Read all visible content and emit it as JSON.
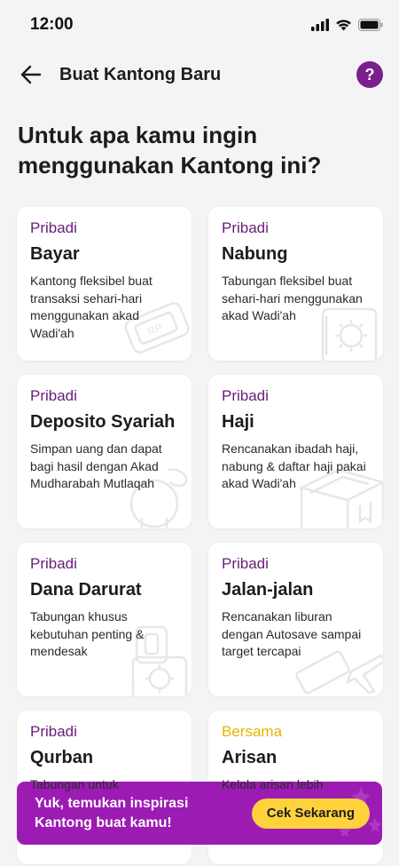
{
  "status_bar": {
    "time": "12:00"
  },
  "header": {
    "title": "Buat Kantong Baru",
    "help_label": "?"
  },
  "question": {
    "line1": "Untuk apa kamu ingin",
    "line2": "menggunakan Kantong ini?"
  },
  "cards": [
    {
      "category": "Pribadi",
      "title": "Bayar",
      "desc": "Kantong fleksibel buat transaksi sehari-hari menggunakan akad Wadi'ah",
      "icon": "card-icon"
    },
    {
      "category": "Pribadi",
      "title": "Nabung",
      "desc": "Tabungan fleksibel buat sehari-hari menggunakan akad Wadi'ah",
      "icon": "piggy-icon"
    },
    {
      "category": "Pribadi",
      "title": "Deposito Syariah",
      "desc": "Simpan uang dan dapat bagi hasil dengan Akad Mudharabah Mutlaqah",
      "icon": "coin-hand-icon"
    },
    {
      "category": "Pribadi",
      "title": "Haji",
      "desc": "Rencanakan ibadah haji, nabung & daftar haji pakai akad Wadi'ah",
      "icon": "kaaba-icon"
    },
    {
      "category": "Pribadi",
      "title": "Dana Darurat",
      "desc": "Tabungan khusus kebutuhan penting & mendesak",
      "icon": "first-aid-icon"
    },
    {
      "category": "Pribadi",
      "title": "Jalan-jalan",
      "desc": "Rencanakan liburan dengan Autosave sampai target tercapai",
      "icon": "airplane-icon"
    },
    {
      "category": "Pribadi",
      "title": "Qurban",
      "desc": "Tabungan untuk",
      "icon": "goat-icon"
    },
    {
      "category": "Bersama",
      "title": "Arisan",
      "desc": "Kelola arisan lebih",
      "icon": "group-icon"
    }
  ],
  "banner": {
    "line1": "Yuk, temukan inspirasi",
    "line2": "Kantong buat kamu!",
    "button_label": "Cek Sekarang"
  },
  "colors": {
    "primary": "#7a1f8d",
    "banner": "#9c1bb3",
    "accent_yellow": "#ffd23c",
    "bersama": "#e8b400"
  }
}
